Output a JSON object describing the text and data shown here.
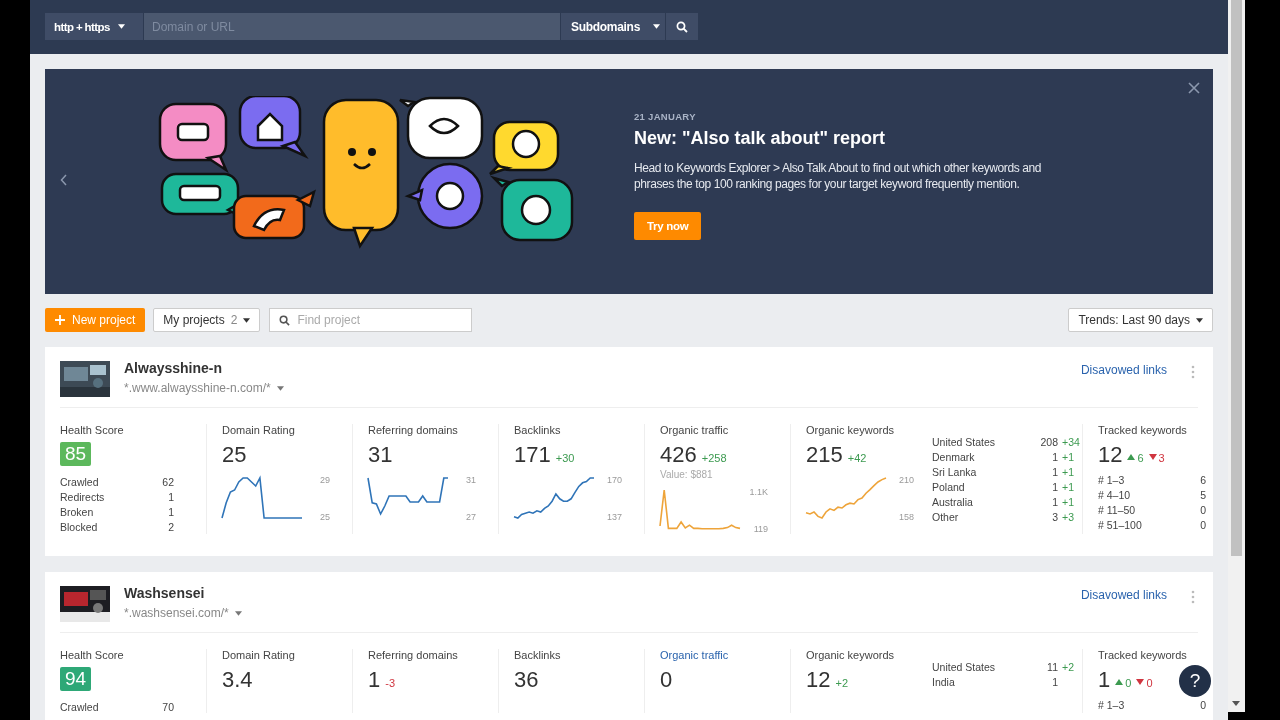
{
  "search_bar": {
    "protocol": "http + https",
    "placeholder": "Domain or URL",
    "mode": "Subdomains"
  },
  "banner": {
    "date": "21 JANUARY",
    "title": "New: \"Also talk about\" report",
    "text": "Head to Keywords Explorer > Also Talk About to find out which other keywords and phrases the top 100 ranking pages for your target keyword frequently mention.",
    "button": "Try now"
  },
  "toolbar": {
    "new_project": "New project",
    "my_projects": "My projects",
    "project_count": "2",
    "find_placeholder": "Find project",
    "trends": "Trends: Last 90 days"
  },
  "projects": [
    {
      "name": "Alwaysshine-n",
      "url": "*.www.alwaysshine-n.com/*",
      "action_link": "Disavowed links",
      "health": {
        "label": "Health Score",
        "score": "85",
        "color": "#5cb85c",
        "stats": [
          {
            "label": "Crawled",
            "value": "62"
          },
          {
            "label": "Redirects",
            "value": "1"
          },
          {
            "label": "Broken",
            "value": "1"
          },
          {
            "label": "Blocked",
            "value": "2"
          }
        ]
      },
      "metrics": [
        {
          "label": "Domain Rating",
          "value": "25",
          "link": false,
          "scale": {
            "max": "29",
            "min": "25"
          }
        },
        {
          "label": "Referring domains",
          "value": "31",
          "link": false,
          "scale": {
            "max": "31",
            "min": "27"
          }
        },
        {
          "label": "Backlinks",
          "value": "171",
          "change": "+30",
          "negative": false,
          "link": false,
          "scale": {
            "max": "170",
            "min": "137"
          }
        },
        {
          "label": "Organic traffic",
          "value": "426",
          "change": "+258",
          "negative": false,
          "note": "Value: $881",
          "link": false,
          "scale": {
            "max": "1.1K",
            "min": "119"
          }
        },
        {
          "label": "Organic keywords",
          "value": "215",
          "change": "+42",
          "negative": false,
          "link": false,
          "scale": {
            "max": "210",
            "min": "158"
          }
        }
      ],
      "countries": [
        {
          "name": "United States",
          "count": "208",
          "change": "+34"
        },
        {
          "name": "Denmark",
          "count": "1",
          "change": "+1"
        },
        {
          "name": "Sri Lanka",
          "count": "1",
          "change": "+1"
        },
        {
          "name": "Poland",
          "count": "1",
          "change": "+1"
        },
        {
          "name": "Australia",
          "count": "1",
          "change": "+1"
        },
        {
          "name": "Other",
          "count": "3",
          "change": "+3"
        }
      ],
      "tracked": {
        "label": "Tracked keywords",
        "value": "12",
        "up": "6",
        "down": "3",
        "buckets": [
          {
            "label": "# 1–3",
            "count": "6"
          },
          {
            "label": "# 4–10",
            "count": "5"
          },
          {
            "label": "# 11–50",
            "count": "0"
          },
          {
            "label": "# 51–100",
            "count": "0"
          }
        ]
      }
    },
    {
      "name": "Washsensei",
      "url": "*.washsensei.com/*",
      "action_link": "Disavowed links",
      "health": {
        "label": "Health Score",
        "score": "94",
        "color": "#2ea877",
        "stats": [
          {
            "label": "Crawled",
            "value": "70"
          }
        ]
      },
      "metrics": [
        {
          "label": "Domain Rating",
          "value": "3.4",
          "link": false
        },
        {
          "label": "Referring domains",
          "value": "1",
          "change": "-3",
          "negative": true,
          "link": false
        },
        {
          "label": "Backlinks",
          "value": "36",
          "link": false
        },
        {
          "label": "Organic traffic",
          "value": "0",
          "link": true
        },
        {
          "label": "Organic keywords",
          "value": "12",
          "change": "+2",
          "negative": false,
          "link": false
        }
      ],
      "countries": [
        {
          "name": "United States",
          "count": "11",
          "change": "+2"
        },
        {
          "name": "India",
          "count": "1"
        }
      ],
      "tracked": {
        "label": "Tracked keywords",
        "value": "1",
        "up": "0",
        "down": "0",
        "buckets": [
          {
            "label": "# 1–3",
            "count": "0"
          }
        ]
      }
    }
  ],
  "help_button": "?"
}
